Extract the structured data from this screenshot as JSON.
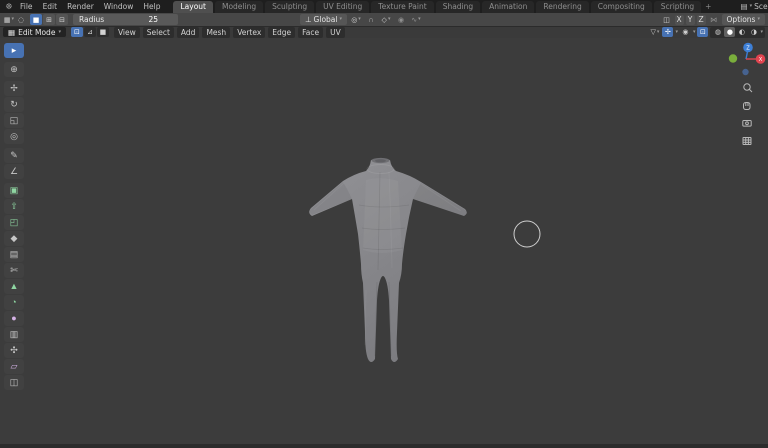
{
  "topbar": {
    "menus": [
      "File",
      "Edit",
      "Render",
      "Window",
      "Help"
    ],
    "tabs": [
      "Layout",
      "Modeling",
      "Sculpting",
      "UV Editing",
      "Texture Paint",
      "Shading",
      "Animation",
      "Rendering",
      "Compositing",
      "Scripting"
    ],
    "active_tab": "Layout",
    "add_tab": "+",
    "scene_label": "Scene"
  },
  "tool_settings": {
    "radius_label": "Radius",
    "radius_value": "25",
    "orientation": "Global",
    "mirror_x": "X",
    "mirror_y": "Y",
    "mirror_z": "Z",
    "options_label": "Options"
  },
  "viewport_header": {
    "mode": "Edit Mode",
    "menus": [
      "View",
      "Select",
      "Add",
      "Mesh",
      "Vertex",
      "Edge",
      "Face",
      "UV"
    ]
  },
  "nav_gizmo": {
    "z_label": "Z",
    "x_label": "X"
  },
  "colors": {
    "accent": "#4772b3",
    "axis_x": "#e2444f",
    "axis_y": "#7aae3c",
    "axis_z": "#3d7fd6",
    "mesh": "#87878b",
    "viewport_bg": "#3c3c3c"
  },
  "icons": {
    "logo": "☸",
    "mode": "▦",
    "circle_tool": "◌",
    "sel_new": "■",
    "sel_extend": "⊞",
    "sel_subtract": "⊟",
    "orientation": "⊥",
    "pivot": "◎",
    "magnet": "∩",
    "snap_target": "◇",
    "proportional": "◉",
    "falloff": "∿",
    "mirror": "◫",
    "symmetry": "⋈",
    "scene": "▤",
    "vertex": "⊡",
    "edge": "⊿",
    "face": "■",
    "funnel": "▽",
    "gizmo": "✢",
    "overlays": "◉",
    "xray": "⊡",
    "shade_wireframe": "◍",
    "shade_solid": "●",
    "shade_material": "◐",
    "shade_rendered": "◑"
  },
  "toolbar": {
    "tools": [
      {
        "name": "select-circle",
        "glyph": "▸",
        "tint": "",
        "active": true
      },
      {
        "name": "cursor",
        "glyph": "⊕",
        "tint": "",
        "gap": true
      },
      {
        "name": "move",
        "glyph": "✢",
        "tint": "",
        "gap": true
      },
      {
        "name": "rotate",
        "glyph": "↻",
        "tint": ""
      },
      {
        "name": "scale",
        "glyph": "◱",
        "tint": ""
      },
      {
        "name": "transform",
        "glyph": "◎",
        "tint": ""
      },
      {
        "name": "annotate",
        "glyph": "✎",
        "tint": "",
        "gap": true
      },
      {
        "name": "measure",
        "glyph": "∠",
        "tint": ""
      },
      {
        "name": "add-cube",
        "glyph": "▣",
        "tint": "green",
        "gap": true
      },
      {
        "name": "extrude-region",
        "glyph": "⇧",
        "tint": "green"
      },
      {
        "name": "inset-faces",
        "glyph": "◰",
        "tint": "green"
      },
      {
        "name": "bevel",
        "glyph": "◆",
        "tint": ""
      },
      {
        "name": "loop-cut",
        "glyph": "▤",
        "tint": ""
      },
      {
        "name": "knife",
        "glyph": "✄",
        "tint": ""
      },
      {
        "name": "poly-build",
        "glyph": "▲",
        "tint": "green"
      },
      {
        "name": "spin",
        "glyph": "◔",
        "tint": "green"
      },
      {
        "name": "smooth",
        "glyph": "●",
        "tint": "purple"
      },
      {
        "name": "edge-slide",
        "glyph": "▥",
        "tint": ""
      },
      {
        "name": "shrink-fatten",
        "glyph": "✣",
        "tint": ""
      },
      {
        "name": "shear",
        "glyph": "▱",
        "tint": "purple"
      },
      {
        "name": "rip-region",
        "glyph": "◫",
        "tint": ""
      }
    ]
  }
}
